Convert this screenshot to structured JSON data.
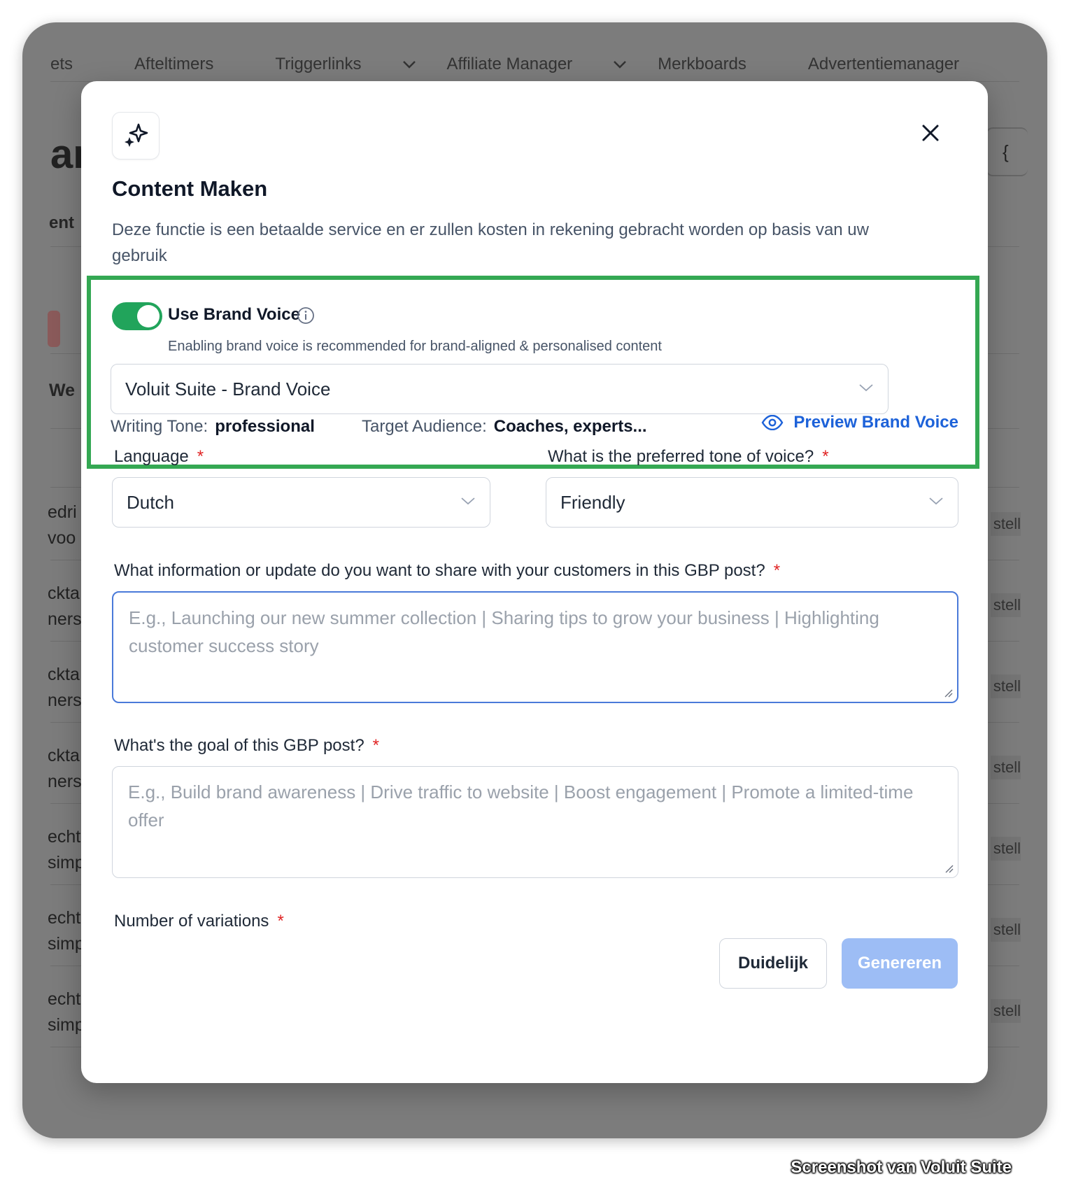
{
  "background": {
    "nav": [
      {
        "label": "ets",
        "chevron": false
      },
      {
        "label": "Afteltimers",
        "chevron": false
      },
      {
        "label": "Triggerlinks",
        "chevron": true
      },
      {
        "label": "Affiliate Manager",
        "chevron": true
      },
      {
        "label": "Merkboards",
        "chevron": false
      },
      {
        "label": "Advertentiemanager",
        "chevron": false
      }
    ],
    "title_fragment": "ar",
    "tab_fragment": "ent",
    "section_fragment": "We",
    "icon_fragment": "{",
    "rows": [
      {
        "line1": "edri",
        "line2": "voo",
        "action": "stell"
      },
      {
        "line1": "ckta",
        "line2": "ners",
        "action": "stell"
      },
      {
        "line1": "ckta",
        "line2": "ners",
        "action": "stell"
      },
      {
        "line1": "ckta",
        "line2": "ners",
        "action": "stell"
      },
      {
        "line1": "echt",
        "line2": "simp",
        "action": "stell"
      },
      {
        "line1": "echt",
        "line2": "simp",
        "action": "stell"
      },
      {
        "line1": "echt",
        "line2": "simp",
        "action": "stell"
      }
    ]
  },
  "modal": {
    "icon": "sparkles-icon",
    "title": "Content Maken",
    "description": "Deze functie is een betaalde service en er zullen kosten in rekening gebracht worden op basis van uw gebruik",
    "brand_voice": {
      "toggle_on": true,
      "label": "Use Brand Voice",
      "sublabel": "Enabling brand voice is recommended for brand-aligned & personalised content",
      "selected": "Voluit Suite - Brand Voice",
      "writing_tone_label": "Writing Tone:",
      "writing_tone_value": "professional",
      "audience_label": "Target Audience:",
      "audience_value": "Coaches, experts...",
      "preview_label": "Preview Brand Voice",
      "highlight_color": "#34a853"
    },
    "language": {
      "label": "Language",
      "required": "*",
      "value": "Dutch"
    },
    "tone": {
      "label": "What is the preferred tone of voice?",
      "required": "*",
      "value": "Friendly"
    },
    "info": {
      "label": "What information or update do you want to share with your customers in this GBP post?",
      "required": "*",
      "placeholder": "E.g., Launching our new summer collection | Sharing tips to grow your business | Highlighting customer success story"
    },
    "goal": {
      "label": "What's the goal of this GBP post?",
      "required": "*",
      "placeholder": "E.g., Build brand awareness | Drive traffic to website | Boost engagement | Promote a limited-time offer"
    },
    "variations": {
      "label": "Number of variations",
      "required": "*"
    },
    "buttons": {
      "clear": "Duidelijk",
      "generate": "Genereren"
    },
    "colors": {
      "toggle": "#21a45b",
      "link": "#1d62d9",
      "generate_disabled": "#9dbdf5"
    }
  },
  "watermark": "Screenshot van Voluit Suite"
}
